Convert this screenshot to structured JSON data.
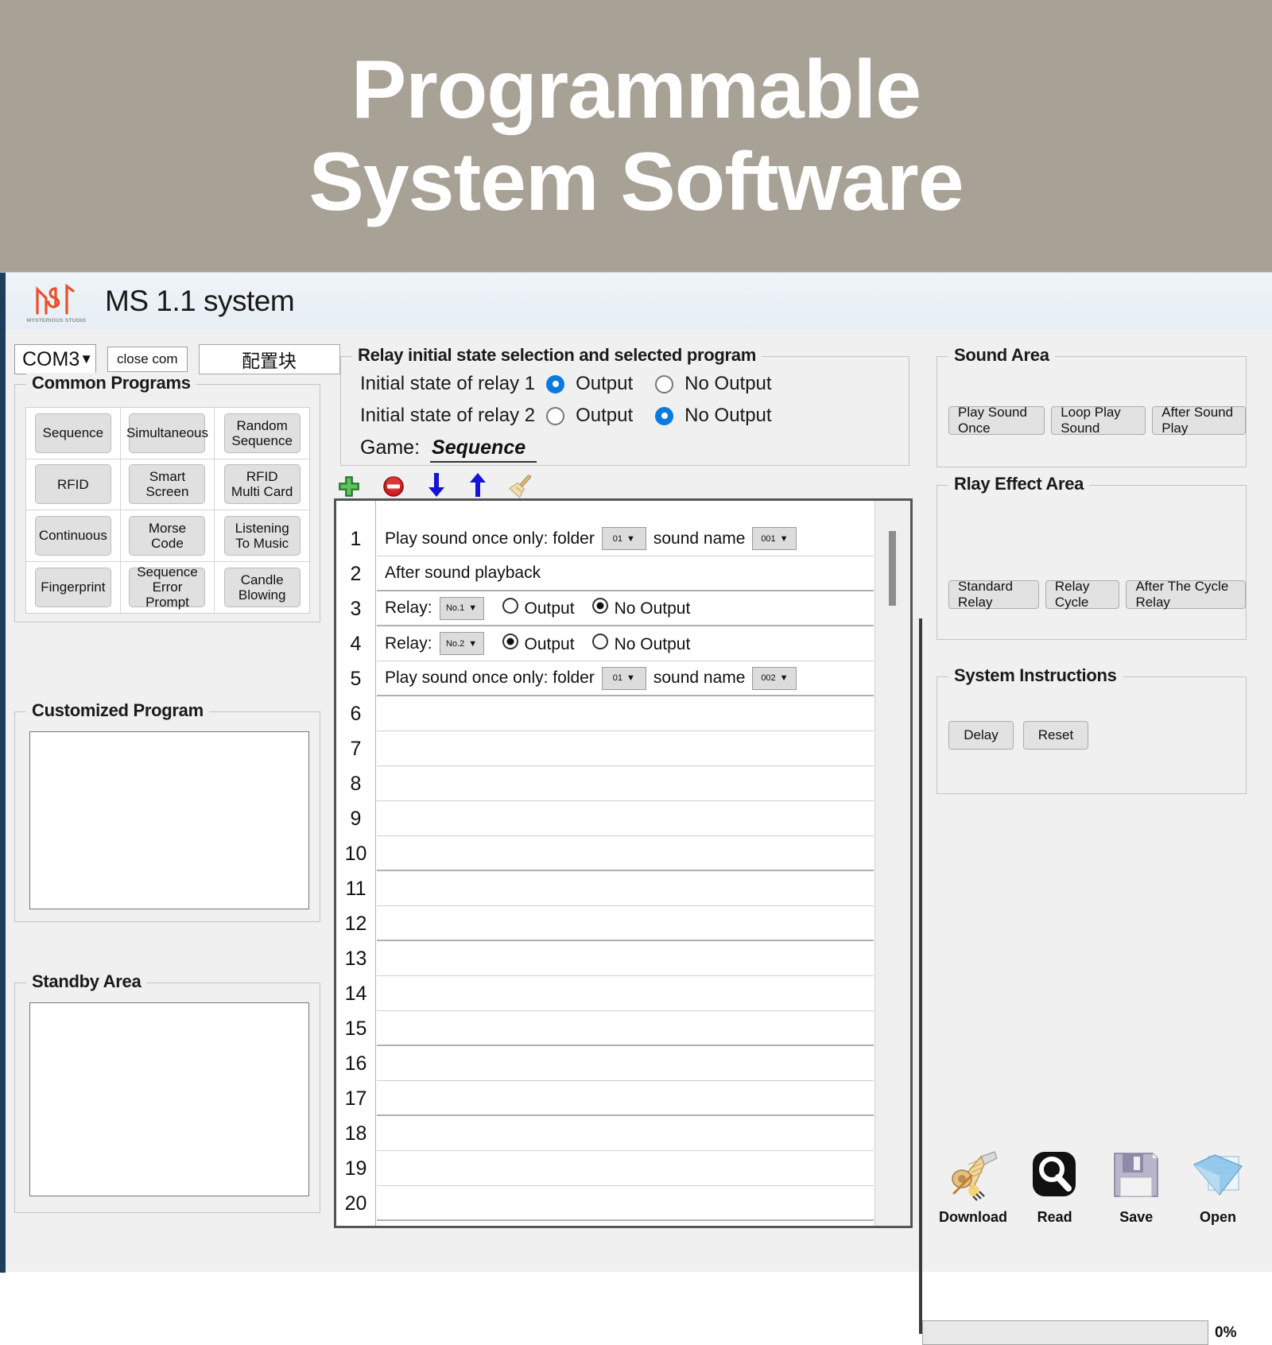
{
  "banner": {
    "line1": "Programmable",
    "line2": "System Software",
    "bg": "#a8a195",
    "text_color": "#ffffff"
  },
  "titlebar": {
    "app_title": "MS 1.1 system",
    "logo_subtext": "MYSTERIOUS STUDIO",
    "logo_color": "#e8502a"
  },
  "com_row": {
    "port_value": "COM3",
    "caret": "▼",
    "close_com_label": "close com",
    "config_label": "配置块"
  },
  "common_programs": {
    "legend": "Common Programs",
    "buttons": [
      "Sequence",
      "Simultaneous",
      "Random\nSequence",
      "RFID",
      "Smart\nScreen",
      "RFID\nMulti Card",
      "Continuous",
      "Morse Code",
      "Listening\nTo Music",
      "Fingerprint",
      "Sequence\nError Prompt",
      "Candle\nBlowing"
    ]
  },
  "customized_program": {
    "legend": "Customized Program",
    "content": ""
  },
  "standby_area": {
    "legend": "Standby Area",
    "content": ""
  },
  "relay_group": {
    "legend": "Relay initial state selection and selected program",
    "relay1": {
      "label": "Initial state of relay 1",
      "output_label": "Output",
      "no_output_label": "No Output",
      "selected": "output"
    },
    "relay2": {
      "label": "Initial state of relay 2",
      "output_label": "Output",
      "no_output_label": "No Output",
      "selected": "no_output"
    },
    "game_label": "Game:",
    "game_value": "Sequence"
  },
  "icon_strip": [
    {
      "name": "add-icon",
      "title": "Add"
    },
    {
      "name": "delete-icon",
      "title": "Delete"
    },
    {
      "name": "move-down-icon",
      "title": "Move Down"
    },
    {
      "name": "move-up-icon",
      "title": "Move Up"
    },
    {
      "name": "clear-broom-icon",
      "title": "Clear"
    }
  ],
  "program_list": {
    "row_count": 20,
    "rows": [
      {
        "n": "1",
        "type": "sound",
        "text_before": "Play sound once only: folder",
        "folder": "01",
        "text_mid": "sound name",
        "sound": "001"
      },
      {
        "n": "2",
        "type": "text",
        "text": "After sound playback"
      },
      {
        "n": "3",
        "type": "relay",
        "label": "Relay:",
        "relay": "No.1",
        "output_label": "Output",
        "no_output_label": "No Output",
        "selected": "no_output"
      },
      {
        "n": "4",
        "type": "relay",
        "label": "Relay:",
        "relay": "No.2",
        "output_label": "Output",
        "no_output_label": "No Output",
        "selected": "output"
      },
      {
        "n": "5",
        "type": "sound",
        "text_before": "Play sound once only: folder",
        "folder": "01",
        "text_mid": "sound name",
        "sound": "002"
      },
      {
        "n": "6",
        "type": "empty"
      },
      {
        "n": "7",
        "type": "empty"
      },
      {
        "n": "8",
        "type": "empty"
      },
      {
        "n": "9",
        "type": "empty"
      },
      {
        "n": "10",
        "type": "empty"
      },
      {
        "n": "11",
        "type": "empty"
      },
      {
        "n": "12",
        "type": "empty"
      },
      {
        "n": "13",
        "type": "empty"
      },
      {
        "n": "14",
        "type": "empty"
      },
      {
        "n": "15",
        "type": "empty"
      },
      {
        "n": "16",
        "type": "empty"
      },
      {
        "n": "17",
        "type": "empty"
      },
      {
        "n": "18",
        "type": "empty"
      },
      {
        "n": "19",
        "type": "empty"
      },
      {
        "n": "20",
        "type": "empty"
      }
    ]
  },
  "sound_area": {
    "legend": "Sound Area",
    "buttons": [
      "Play Sound Once",
      "Loop Play Sound",
      "After Sound Play"
    ]
  },
  "relay_effect_area": {
    "legend": "Rlay Effect Area",
    "buttons": [
      "Standard Relay",
      "Relay Cycle",
      "After The Cycle Relay"
    ]
  },
  "system_instructions": {
    "legend": "System Instructions",
    "buttons": [
      "Delay",
      "Reset"
    ]
  },
  "big_icons": [
    {
      "name": "download-scroll-icon",
      "label": "Download"
    },
    {
      "name": "read-magnifier-icon",
      "label": "Read"
    },
    {
      "name": "save-floppy-icon",
      "label": "Save"
    },
    {
      "name": "open-folder-icon",
      "label": "Open"
    }
  ],
  "progress": {
    "percent_label": "0%",
    "value": 0
  }
}
